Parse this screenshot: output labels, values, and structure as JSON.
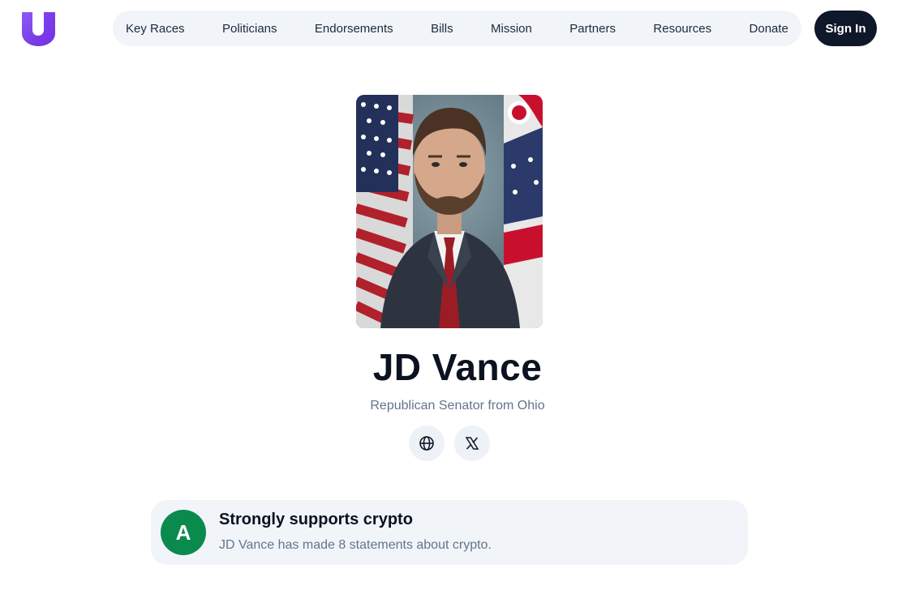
{
  "header": {
    "nav": [
      "Key Races",
      "Politicians",
      "Endorsements",
      "Bills",
      "Mission",
      "Partners",
      "Resources",
      "Donate"
    ],
    "sign_in_label": "Sign In"
  },
  "profile": {
    "name": "JD Vance",
    "subtitle": "Republican Senator from Ohio",
    "social_icons": [
      "globe-icon",
      "x-logo-icon"
    ]
  },
  "rating": {
    "grade": "A",
    "title": "Strongly supports crypto",
    "description": "JD Vance has made 8 statements about crypto."
  },
  "colors": {
    "brand_purple": "#7c3aed",
    "dark": "#0f172a",
    "grade_green": "#0b8a4e"
  }
}
